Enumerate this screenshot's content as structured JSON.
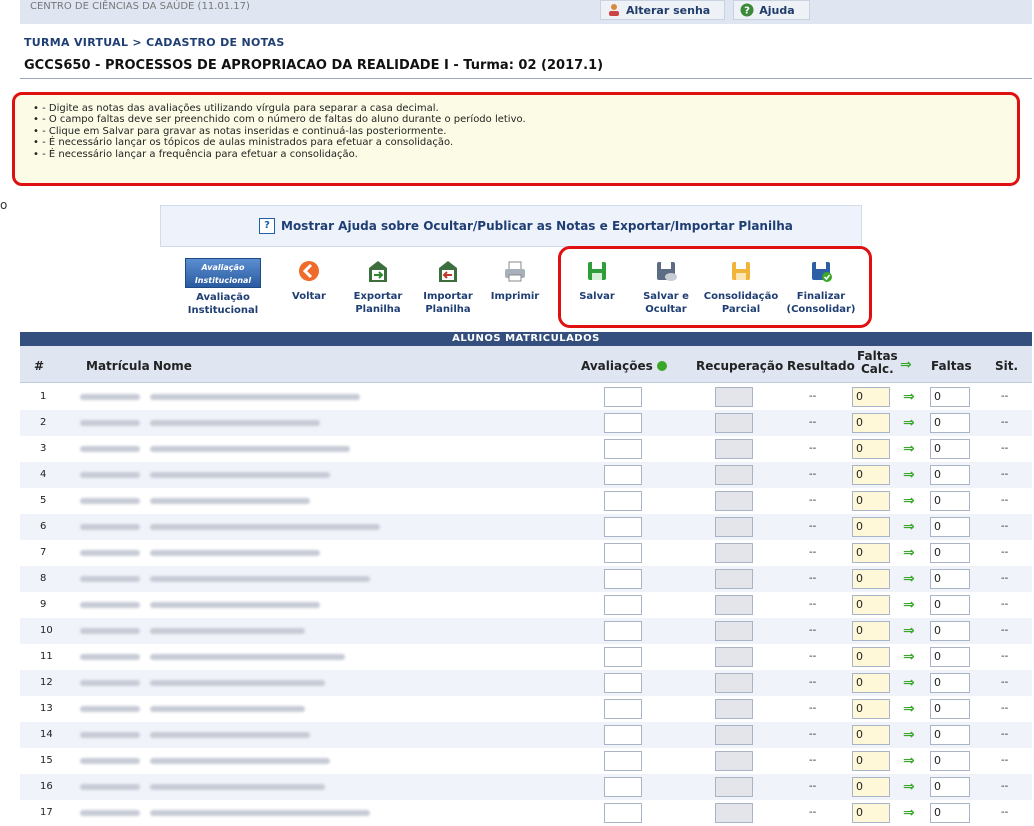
{
  "top_bar": {
    "unit_text": "CENTRO DE CIÊNCIAS DA SAÚDE (11.01.17)",
    "change_password_label": "Alterar senha",
    "help_label": "Ajuda"
  },
  "breadcrumb": "Turma Virtual > Cadastro de Notas",
  "page_title": "GCCS650 - PROCESSOS DE APROPRIACAO DA REALIDADE I - Turma: 02 (2017.1)",
  "instructions": [
    "• - Digite as notas das avaliações utilizando vírgula para separar a casa decimal.",
    "• - O campo faltas deve ser preenchido com o número de faltas do aluno durante o período letivo.",
    "• - Clique em Salvar para gravar as notas inseridas e continuá-las posteriormente.",
    "• - É necessário lançar os tópicos de aulas ministrados para efetuar a consolidação.",
    "• - É necessário lançar a frequência para efetuar a consolidação."
  ],
  "left_margin_char": "o",
  "help_link": "Mostrar Ajuda sobre Ocultar/Publicar as Notas e Exportar/Importar Planilha",
  "toolbar": {
    "avaliacao_icon_text": "Avaliação Institucional",
    "buttons": [
      {
        "line1": "Avaliação",
        "line2": "Institucional",
        "icon": "institutional-evaluation-icon"
      },
      {
        "line1": "Voltar",
        "line2": "",
        "icon": "back-arrow-icon"
      },
      {
        "line1": "Exportar",
        "line2": "Planilha",
        "icon": "export-spreadsheet-icon"
      },
      {
        "line1": "Importar",
        "line2": "Planilha",
        "icon": "import-spreadsheet-icon"
      },
      {
        "line1": "Imprimir",
        "line2": "",
        "icon": "printer-icon"
      },
      {
        "line1": "Salvar",
        "line2": "",
        "icon": "save-icon"
      },
      {
        "line1": "Salvar e",
        "line2": "Ocultar",
        "icon": "save-hide-icon"
      },
      {
        "line1": "Consolidação",
        "line2": "Parcial",
        "icon": "partial-consolidation-icon"
      },
      {
        "line1": "Finalizar",
        "line2": "(Consolidar)",
        "icon": "finalize-icon"
      }
    ]
  },
  "table": {
    "section_title": "ALUNOS MATRICULADOS",
    "headers": {
      "num": "#",
      "matricula": "Matrícula",
      "nome": "Nome",
      "avaliacoes": "Avaliações",
      "recuperacao": "Recuperação",
      "resultado": "Resultado",
      "faltas_calc_1": "Faltas",
      "faltas_calc_2": "Calc.",
      "faltas": "Faltas",
      "sit": "Sit."
    },
    "rows": [
      {
        "n": "1",
        "resultado": "--",
        "faltas_calc": "0",
        "faltas": "0",
        "sit": "--"
      },
      {
        "n": "2",
        "resultado": "--",
        "faltas_calc": "0",
        "faltas": "0",
        "sit": "--"
      },
      {
        "n": "3",
        "resultado": "--",
        "faltas_calc": "0",
        "faltas": "0",
        "sit": "--"
      },
      {
        "n": "4",
        "resultado": "--",
        "faltas_calc": "0",
        "faltas": "0",
        "sit": "--"
      },
      {
        "n": "5",
        "resultado": "--",
        "faltas_calc": "0",
        "faltas": "0",
        "sit": "--"
      },
      {
        "n": "6",
        "resultado": "--",
        "faltas_calc": "0",
        "faltas": "0",
        "sit": "--"
      },
      {
        "n": "7",
        "resultado": "--",
        "faltas_calc": "0",
        "faltas": "0",
        "sit": "--"
      },
      {
        "n": "8",
        "resultado": "--",
        "faltas_calc": "0",
        "faltas": "0",
        "sit": "--"
      },
      {
        "n": "9",
        "resultado": "--",
        "faltas_calc": "0",
        "faltas": "0",
        "sit": "--"
      },
      {
        "n": "10",
        "resultado": "--",
        "faltas_calc": "0",
        "faltas": "0",
        "sit": "--"
      },
      {
        "n": "11",
        "resultado": "--",
        "faltas_calc": "0",
        "faltas": "0",
        "sit": "--"
      },
      {
        "n": "12",
        "resultado": "--",
        "faltas_calc": "0",
        "faltas": "0",
        "sit": "--"
      },
      {
        "n": "13",
        "resultado": "--",
        "faltas_calc": "0",
        "faltas": "0",
        "sit": "--"
      },
      {
        "n": "14",
        "resultado": "--",
        "faltas_calc": "0",
        "faltas": "0",
        "sit": "--"
      },
      {
        "n": "15",
        "resultado": "--",
        "faltas_calc": "0",
        "faltas": "0",
        "sit": "--"
      },
      {
        "n": "16",
        "resultado": "--",
        "faltas_calc": "0",
        "faltas": "0",
        "sit": "--"
      },
      {
        "n": "17",
        "resultado": "--",
        "faltas_calc": "0",
        "faltas": "0",
        "sit": "--"
      }
    ]
  },
  "colors": {
    "highlight": "#e01010",
    "header_bg": "#344e7d",
    "link_blue": "#1f3e73",
    "arrow_green": "#3aa72a"
  }
}
